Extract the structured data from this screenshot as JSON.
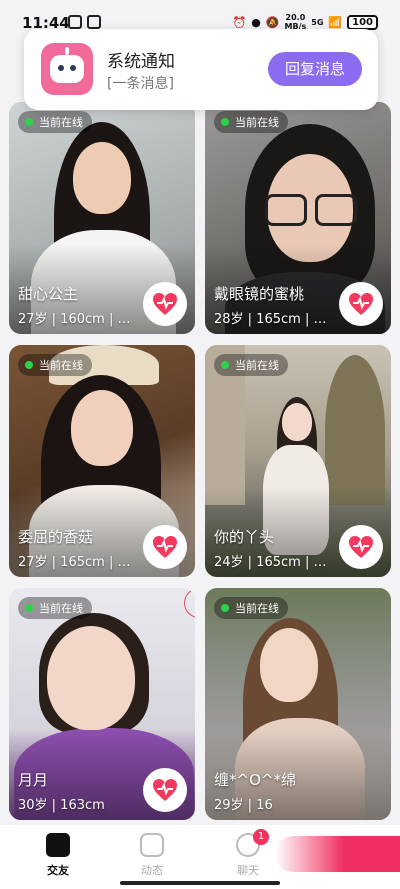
{
  "status_bar": {
    "time": "11:44",
    "net_speed_value": "20.0",
    "net_speed_unit": "MB/s",
    "signal": "5G",
    "battery": "100"
  },
  "notification": {
    "title": "系统通知",
    "subtitle": "[一条消息]",
    "reply_button": "回复消息",
    "accent_color": "#8b6cf0"
  },
  "cards": [
    {
      "online_label": "当前在线",
      "name": "甜心公主",
      "info": "27岁 | 160cm | …"
    },
    {
      "online_label": "当前在线",
      "name": "戴眼镜的蜜桃",
      "info": "28岁 | 165cm | …"
    },
    {
      "online_label": "当前在线",
      "name": "委屈的香菇",
      "info": "27岁 | 165cm | …"
    },
    {
      "online_label": "当前在线",
      "name": "你的丫头",
      "info": "24岁 | 165cm | …"
    },
    {
      "online_label": "当前在线",
      "name": "月月",
      "info": "30岁 | 163cm"
    },
    {
      "online_label": "当前在线",
      "name": "缠*^O^*绵",
      "info": "29岁 | 16"
    }
  ],
  "bottom_nav": {
    "items": [
      {
        "label": "交友",
        "icon": "cards-icon",
        "active": true
      },
      {
        "label": "动态",
        "icon": "moments-icon",
        "active": false
      },
      {
        "label": "聊天",
        "icon": "chat-icon",
        "active": false,
        "badge": "1"
      }
    ]
  },
  "colors": {
    "online_dot": "#2fd14a",
    "like_heart": "#f23a5e",
    "badge": "#f2335d"
  }
}
